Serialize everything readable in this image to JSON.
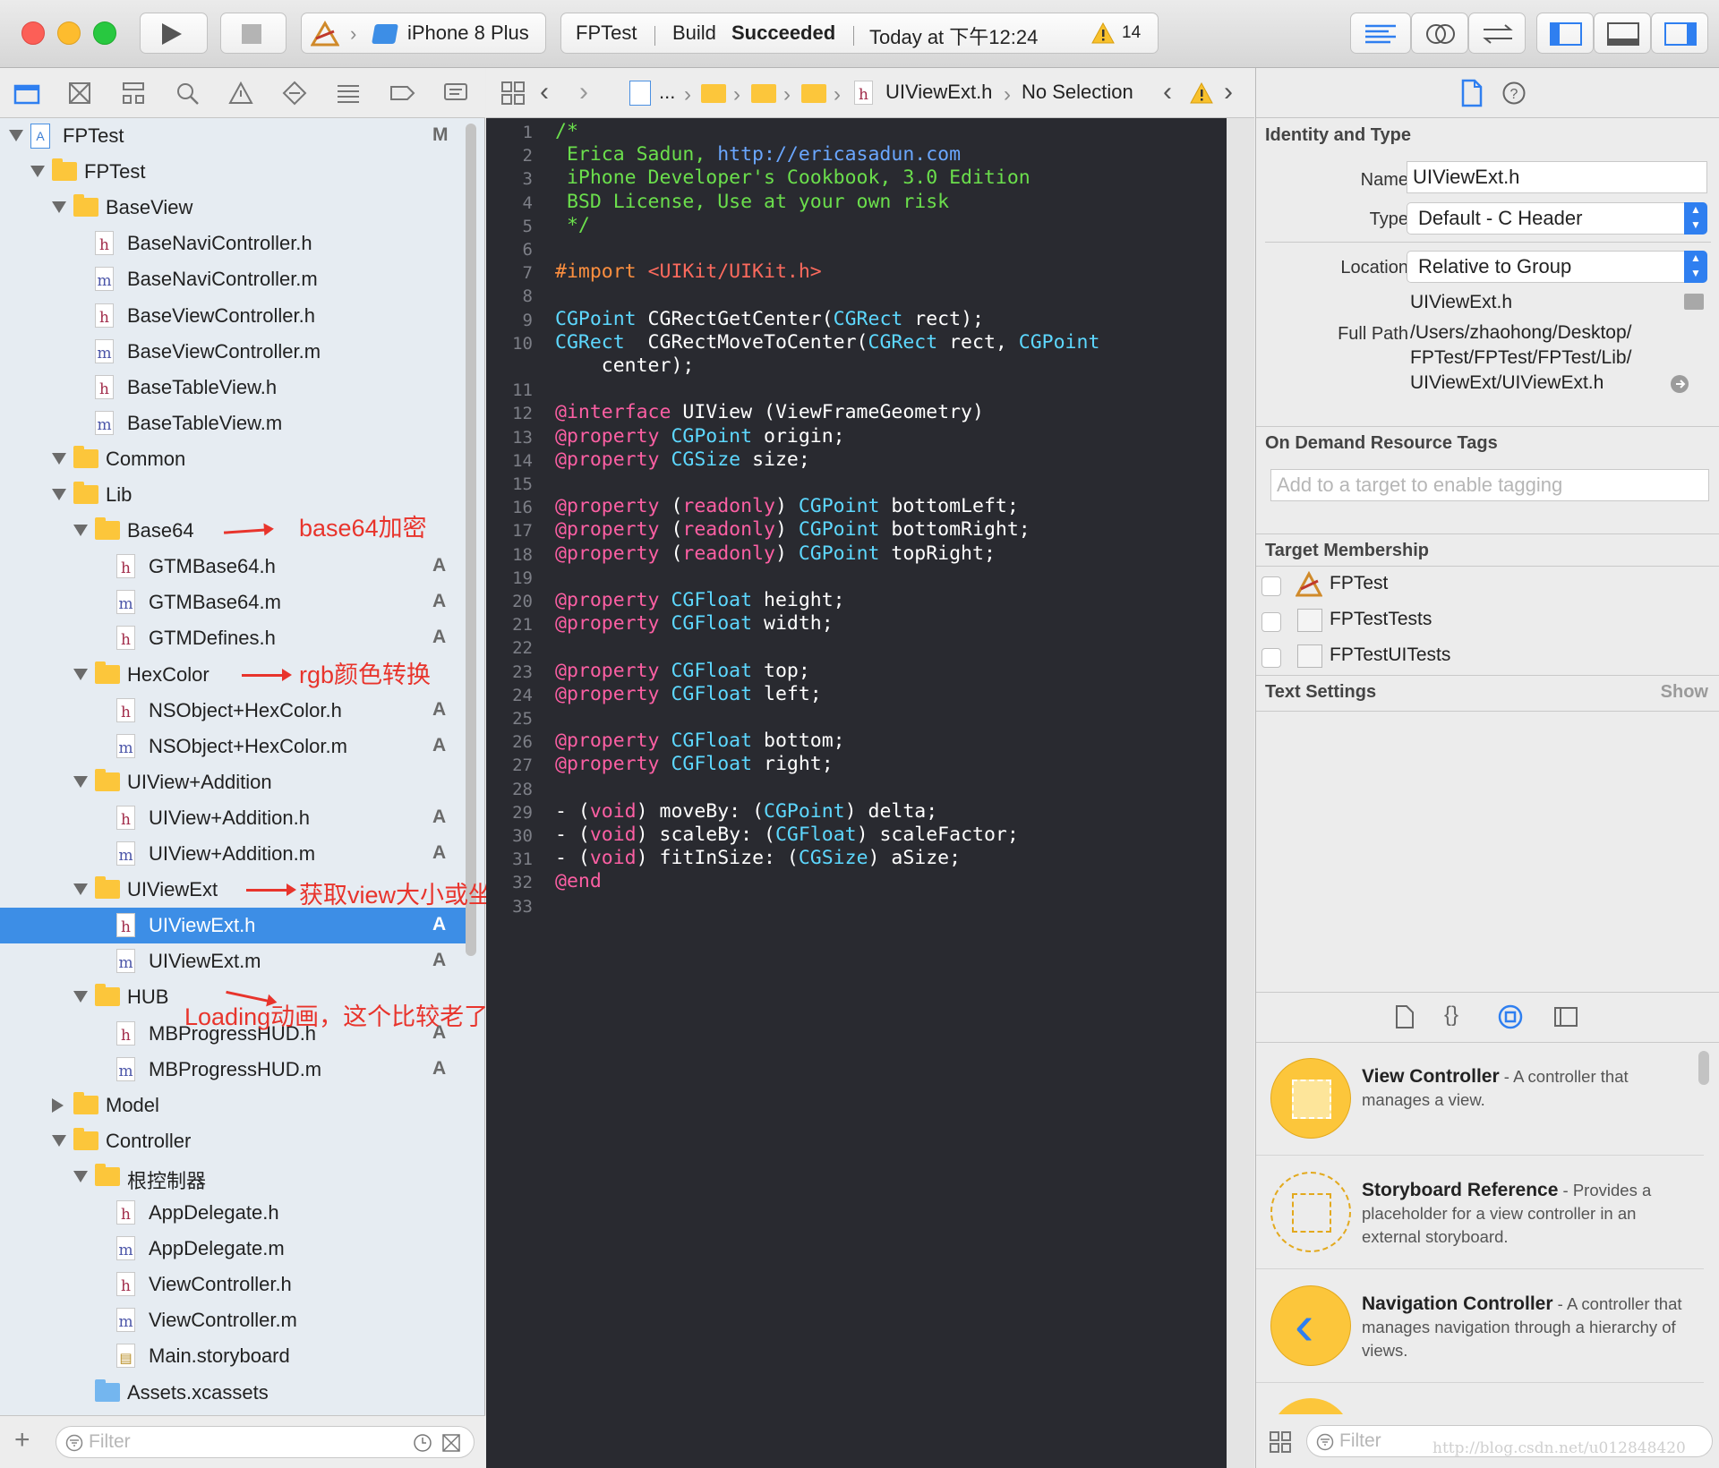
{
  "toolbar": {
    "scheme": "iPhone 8 Plus",
    "activity_project": "FPTest",
    "activity_status_prefix": "Build",
    "activity_status": "Succeeded",
    "activity_time": "Today at 下午12:24",
    "warning_count": "14"
  },
  "navigator": {
    "tree": [
      {
        "label": "FPTest",
        "kind": "project",
        "depth": 0,
        "open": true,
        "badge": "M"
      },
      {
        "label": "FPTest",
        "kind": "folder",
        "depth": 1,
        "open": true,
        "badge": ""
      },
      {
        "label": "BaseView",
        "kind": "folder",
        "depth": 2,
        "open": true,
        "badge": ""
      },
      {
        "label": "BaseNaviController.h",
        "kind": "h",
        "depth": 3,
        "badge": ""
      },
      {
        "label": "BaseNaviController.m",
        "kind": "m",
        "depth": 3,
        "badge": ""
      },
      {
        "label": "BaseViewController.h",
        "kind": "h",
        "depth": 3,
        "badge": ""
      },
      {
        "label": "BaseViewController.m",
        "kind": "m",
        "depth": 3,
        "badge": ""
      },
      {
        "label": "BaseTableView.h",
        "kind": "h",
        "depth": 3,
        "badge": ""
      },
      {
        "label": "BaseTableView.m",
        "kind": "m",
        "depth": 3,
        "badge": ""
      },
      {
        "label": "Common",
        "kind": "folder",
        "depth": 2,
        "open": true,
        "badge": ""
      },
      {
        "label": "Lib",
        "kind": "folder",
        "depth": 2,
        "open": true,
        "badge": ""
      },
      {
        "label": "Base64",
        "kind": "folder",
        "depth": 3,
        "open": true,
        "badge": ""
      },
      {
        "label": "GTMBase64.h",
        "kind": "h",
        "depth": 4,
        "badge": "A"
      },
      {
        "label": "GTMBase64.m",
        "kind": "m",
        "depth": 4,
        "badge": "A"
      },
      {
        "label": "GTMDefines.h",
        "kind": "h",
        "depth": 4,
        "badge": "A"
      },
      {
        "label": "HexColor",
        "kind": "folder",
        "depth": 3,
        "open": true,
        "badge": ""
      },
      {
        "label": "NSObject+HexColor.h",
        "kind": "h",
        "depth": 4,
        "badge": "A"
      },
      {
        "label": "NSObject+HexColor.m",
        "kind": "m",
        "depth": 4,
        "badge": "A"
      },
      {
        "label": "UIView+Addition",
        "kind": "folder",
        "depth": 3,
        "open": true,
        "badge": ""
      },
      {
        "label": "UIView+Addition.h",
        "kind": "h",
        "depth": 4,
        "badge": "A"
      },
      {
        "label": "UIView+Addition.m",
        "kind": "m",
        "depth": 4,
        "badge": "A"
      },
      {
        "label": "UIViewExt",
        "kind": "folder",
        "depth": 3,
        "open": true,
        "badge": ""
      },
      {
        "label": "UIViewExt.h",
        "kind": "h",
        "depth": 4,
        "badge": "A",
        "selected": true
      },
      {
        "label": "UIViewExt.m",
        "kind": "m",
        "depth": 4,
        "badge": "A"
      },
      {
        "label": "HUB",
        "kind": "folder",
        "depth": 3,
        "open": true,
        "badge": ""
      },
      {
        "label": "MBProgressHUD.h",
        "kind": "h",
        "depth": 4,
        "badge": "A"
      },
      {
        "label": "MBProgressHUD.m",
        "kind": "m",
        "depth": 4,
        "badge": "A"
      },
      {
        "label": "Model",
        "kind": "folder",
        "depth": 2,
        "open": false,
        "badge": ""
      },
      {
        "label": "Controller",
        "kind": "folder",
        "depth": 2,
        "open": true,
        "badge": ""
      },
      {
        "label": "根控制器",
        "kind": "folder",
        "depth": 3,
        "open": true,
        "badge": ""
      },
      {
        "label": "AppDelegate.h",
        "kind": "h",
        "depth": 4,
        "badge": ""
      },
      {
        "label": "AppDelegate.m",
        "kind": "m",
        "depth": 4,
        "badge": ""
      },
      {
        "label": "ViewController.h",
        "kind": "h",
        "depth": 4,
        "badge": ""
      },
      {
        "label": "ViewController.m",
        "kind": "m",
        "depth": 4,
        "badge": ""
      },
      {
        "label": "Main.storyboard",
        "kind": "sb",
        "depth": 4,
        "badge": ""
      },
      {
        "label": "Assets.xcassets",
        "kind": "assets",
        "depth": 3,
        "badge": ""
      }
    ],
    "annotations": {
      "base64": "base64加密",
      "hexcolor": "rgb颜色转换",
      "uiviewext": "获取view大小或坐标",
      "hub": "Loading动画，这个比较老了"
    },
    "filter_placeholder": "Filter"
  },
  "jumpbar": {
    "ellipsis": "...",
    "file": "UIViewExt.h",
    "selection": "No Selection"
  },
  "editor": {
    "lines": [
      [
        [
          "c-com",
          "/*"
        ]
      ],
      [
        [
          "c-com",
          " Erica Sadun, "
        ],
        [
          "c-url",
          "http://ericasadun.com"
        ]
      ],
      [
        [
          "c-com",
          " iPhone Developer's Cookbook, 3.0 Edition"
        ]
      ],
      [
        [
          "c-com",
          " BSD License, Use at your own risk"
        ]
      ],
      [
        [
          "c-com",
          " */"
        ]
      ],
      [],
      [
        [
          "c-pre",
          "#import "
        ],
        [
          "c-str",
          "<UIKit/UIKit.h>"
        ]
      ],
      [],
      [
        [
          "c-type",
          "CGPoint"
        ],
        [
          "c-fn",
          " CGRectGetCenter("
        ],
        [
          "c-type",
          "CGRect"
        ],
        [
          "c-fn",
          " rect);"
        ]
      ],
      [
        [
          "c-type",
          "CGRect"
        ],
        [
          "c-fn",
          "  CGRectMoveToCenter("
        ],
        [
          "c-type",
          "CGRect"
        ],
        [
          "c-fn",
          " rect, "
        ],
        [
          "c-type",
          "CGPoint"
        ]
      ],
      "wrap",
      [],
      [
        [
          "c-kw",
          "@interface"
        ],
        [
          "c-fn",
          " UIView (ViewFrameGeometry)"
        ]
      ],
      [
        [
          "c-kw",
          "@property"
        ],
        [
          "c-fn",
          " "
        ],
        [
          "c-type",
          "CGPoint"
        ],
        [
          "c-fn",
          " origin;"
        ]
      ],
      [
        [
          "c-kw",
          "@property"
        ],
        [
          "c-fn",
          " "
        ],
        [
          "c-type",
          "CGSize"
        ],
        [
          "c-fn",
          " size;"
        ]
      ],
      [],
      [
        [
          "c-kw",
          "@property"
        ],
        [
          "c-fn",
          " ("
        ],
        [
          "c-kw",
          "readonly"
        ],
        [
          "c-fn",
          ") "
        ],
        [
          "c-type",
          "CGPoint"
        ],
        [
          "c-fn",
          " bottomLeft;"
        ]
      ],
      [
        [
          "c-kw",
          "@property"
        ],
        [
          "c-fn",
          " ("
        ],
        [
          "c-kw",
          "readonly"
        ],
        [
          "c-fn",
          ") "
        ],
        [
          "c-type",
          "CGPoint"
        ],
        [
          "c-fn",
          " bottomRight;"
        ]
      ],
      [
        [
          "c-kw",
          "@property"
        ],
        [
          "c-fn",
          " ("
        ],
        [
          "c-kw",
          "readonly"
        ],
        [
          "c-fn",
          ") "
        ],
        [
          "c-type",
          "CGPoint"
        ],
        [
          "c-fn",
          " topRight;"
        ]
      ],
      [],
      [
        [
          "c-kw",
          "@property"
        ],
        [
          "c-fn",
          " "
        ],
        [
          "c-type",
          "CGFloat"
        ],
        [
          "c-fn",
          " height;"
        ]
      ],
      [
        [
          "c-kw",
          "@property"
        ],
        [
          "c-fn",
          " "
        ],
        [
          "c-type",
          "CGFloat"
        ],
        [
          "c-fn",
          " width;"
        ]
      ],
      [],
      [
        [
          "c-kw",
          "@property"
        ],
        [
          "c-fn",
          " "
        ],
        [
          "c-type",
          "CGFloat"
        ],
        [
          "c-fn",
          " top;"
        ]
      ],
      [
        [
          "c-kw",
          "@property"
        ],
        [
          "c-fn",
          " "
        ],
        [
          "c-type",
          "CGFloat"
        ],
        [
          "c-fn",
          " left;"
        ]
      ],
      [],
      [
        [
          "c-kw",
          "@property"
        ],
        [
          "c-fn",
          " "
        ],
        [
          "c-type",
          "CGFloat"
        ],
        [
          "c-fn",
          " bottom;"
        ]
      ],
      [
        [
          "c-kw",
          "@property"
        ],
        [
          "c-fn",
          " "
        ],
        [
          "c-type",
          "CGFloat"
        ],
        [
          "c-fn",
          " right;"
        ]
      ],
      [],
      [
        [
          "c-fn",
          "- ("
        ],
        [
          "c-kw",
          "void"
        ],
        [
          "c-fn",
          ") moveBy: ("
        ],
        [
          "c-type",
          "CGPoint"
        ],
        [
          "c-fn",
          ") delta;"
        ]
      ],
      [
        [
          "c-fn",
          "- ("
        ],
        [
          "c-kw",
          "void"
        ],
        [
          "c-fn",
          ") scaleBy: ("
        ],
        [
          "c-type",
          "CGFloat"
        ],
        [
          "c-fn",
          ") scaleFactor;"
        ]
      ],
      [
        [
          "c-fn",
          "- ("
        ],
        [
          "c-kw",
          "void"
        ],
        [
          "c-fn",
          ") fitInSize: ("
        ],
        [
          "c-type",
          "CGSize"
        ],
        [
          "c-fn",
          ") aSize;"
        ]
      ],
      [
        [
          "c-kw",
          "@end"
        ]
      ],
      []
    ],
    "wrap_text": "    center);"
  },
  "inspector": {
    "identity_title": "Identity and Type",
    "name_label": "Name",
    "name_value": "UIViewExt.h",
    "type_label": "Type",
    "type_value": "Default - C Header",
    "location_label": "Location",
    "location_value": "Relative to Group",
    "location_file": "UIViewExt.h",
    "fullpath_label": "Full Path",
    "fullpath_1": "/Users/zhaohong/Desktop/",
    "fullpath_2": "FPTest/FPTest/FPTest/Lib/",
    "fullpath_3": "UIViewExt/UIViewExt.h",
    "odr_title": "On Demand Resource Tags",
    "odr_placeholder": "Add to a target to enable tagging",
    "target_title": "Target Membership",
    "targets": [
      "FPTest",
      "FPTestTests",
      "FPTestUITests"
    ],
    "text_settings_title": "Text Settings",
    "text_settings_show": "Show",
    "library": [
      {
        "title": "View Controller",
        "desc": " - A controller that manages a view."
      },
      {
        "title": "Storyboard Reference",
        "desc": " - Provides a placeholder for a view controller in an external storyboard."
      },
      {
        "title": "Navigation Controller",
        "desc": " - A controller that manages navigation through a hierarchy of views."
      }
    ],
    "filter_placeholder": "Filter"
  },
  "watermark": "http://blog.csdn.net/u012848420",
  "colors": {
    "selection": "#3d8ee6",
    "editor_bg": "#292a30",
    "annotation_red": "#e8342c",
    "library_yellow": "#fcc63b"
  }
}
